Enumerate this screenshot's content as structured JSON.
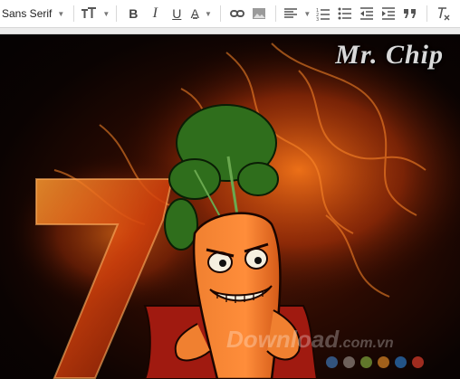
{
  "toolbar": {
    "font_family": "Sans Serif",
    "icons": [
      "font-size-icon",
      "bold-icon",
      "italic-icon",
      "underline-icon",
      "text-color-icon",
      "link-icon",
      "image-icon",
      "align-icon",
      "numbered-list-icon",
      "bulleted-list-icon",
      "indent-less-icon",
      "indent-more-icon",
      "quote-icon",
      "remove-formatting-icon"
    ],
    "bold_label": "B",
    "italic_label": "I",
    "underline_label": "U",
    "text_color_label": "A"
  },
  "image": {
    "title_text": "Mr. Chip",
    "watermark": "Download",
    "watermark_domain": ".com.vn",
    "dot_colors": [
      "#3b6da8",
      "#8a7f78",
      "#7a9d3a",
      "#d07f24",
      "#2a6fb6",
      "#d03a2a"
    ]
  }
}
